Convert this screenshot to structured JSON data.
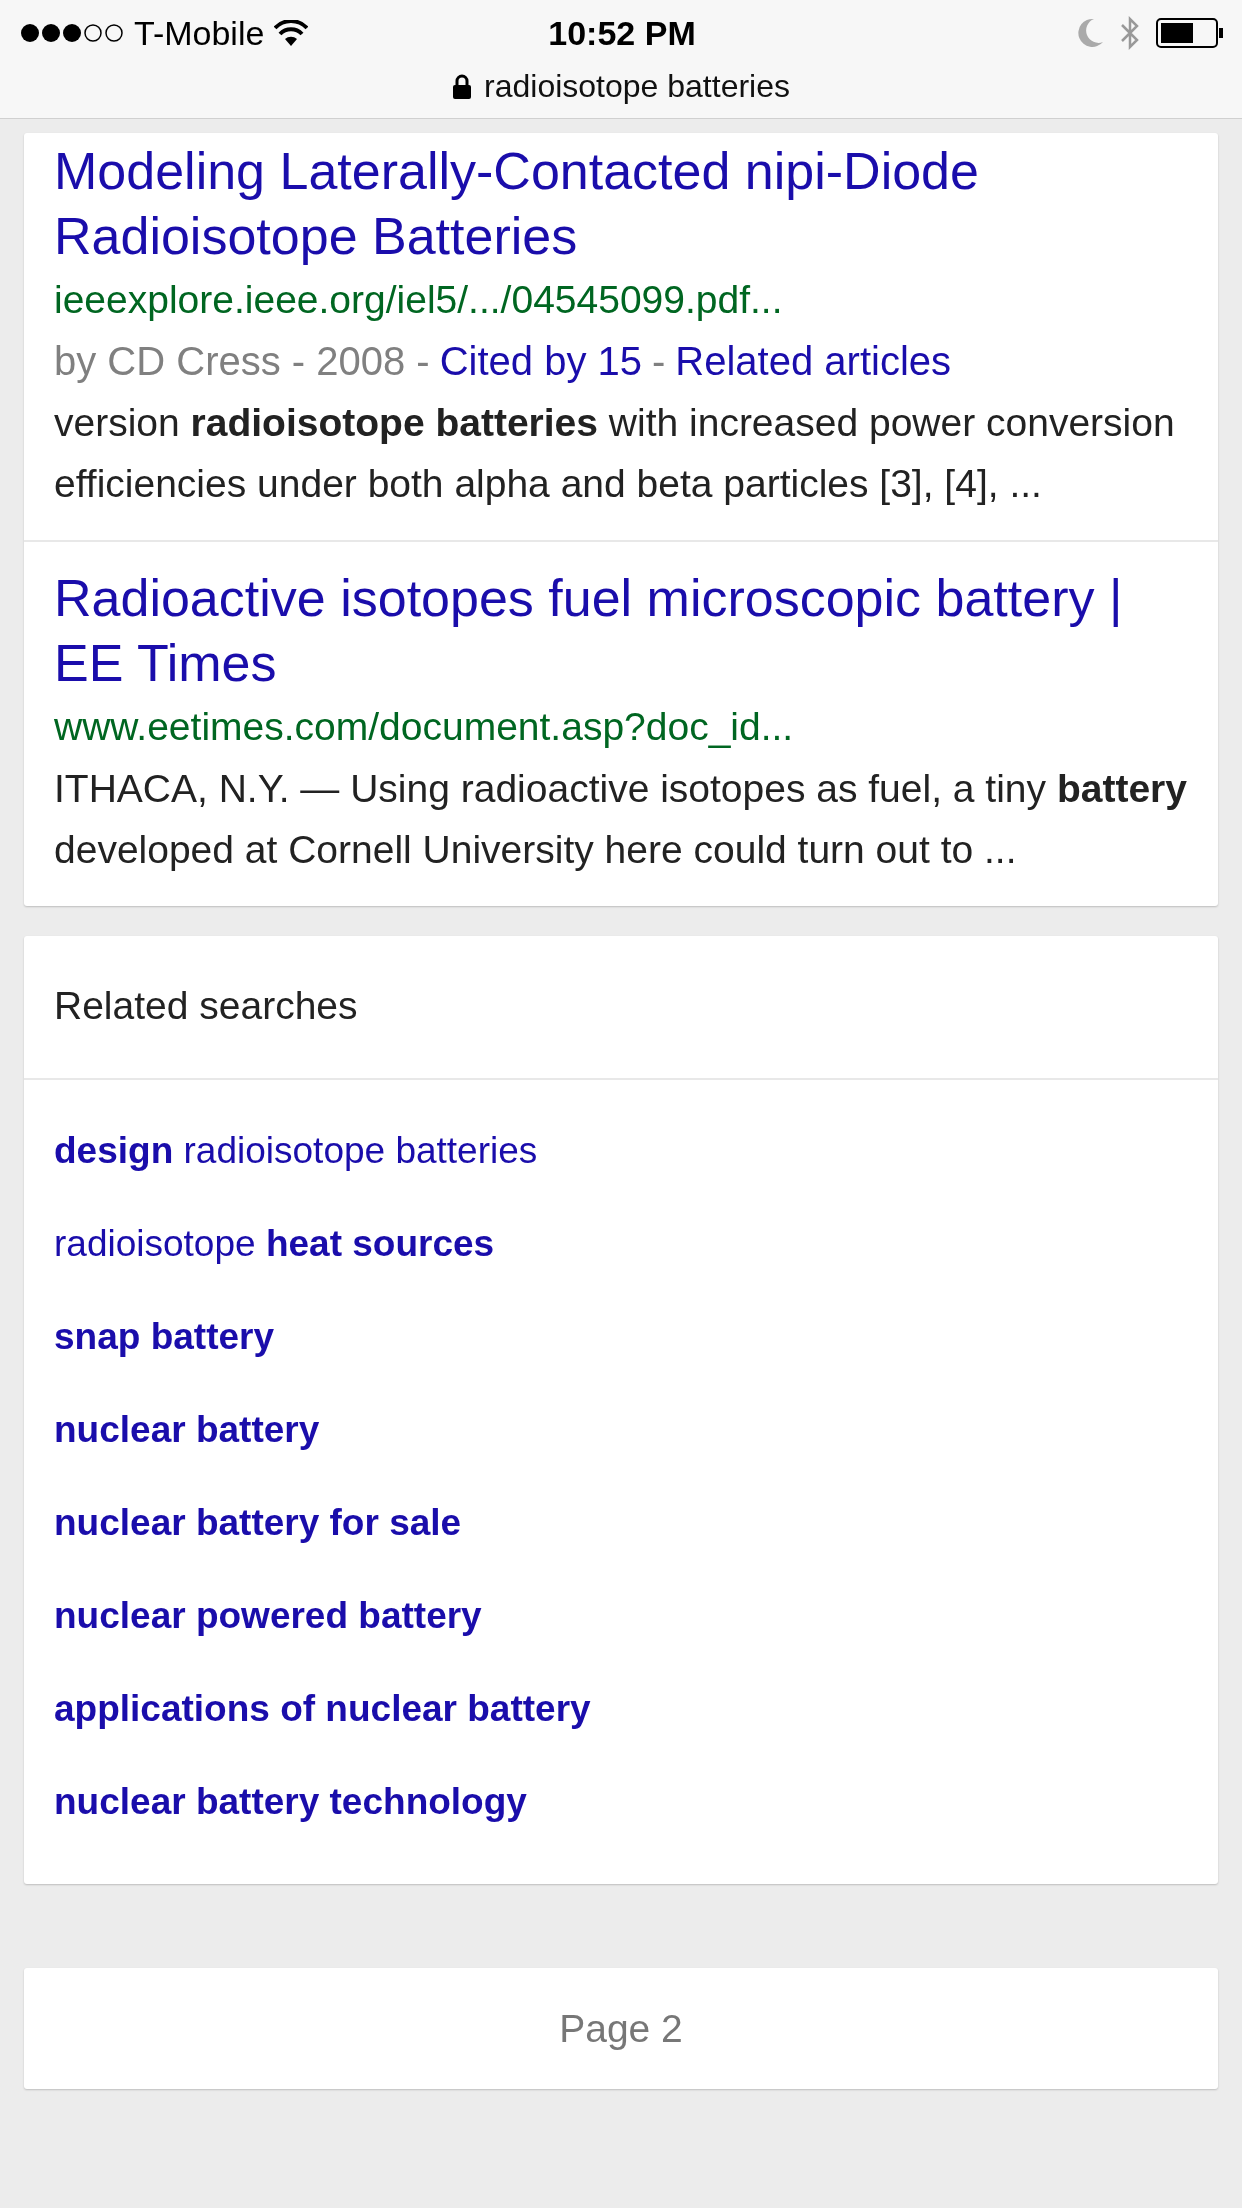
{
  "status_bar": {
    "carrier": "T-Mobile",
    "time": "10:52 PM"
  },
  "address_bar": {
    "text": "radioisotope batteries"
  },
  "results": [
    {
      "title": "Modeling Laterally-Contacted nipi-Diode Radioisotope Batteries",
      "url": "ieeexplore.ieee.org/iel5/.../04545099.pdf...",
      "meta": [
        {
          "kind": "plain",
          "text": "by CD Cress - 2008 -"
        },
        {
          "kind": "link",
          "text": "Cited by 15"
        },
        {
          "kind": "plain",
          "text": "-"
        },
        {
          "kind": "link",
          "text": "Related articles"
        }
      ],
      "snippet": "version **radioisotope batteries** with increased power conversion efficiencies under both alpha and beta particles [3], [4], ..."
    },
    {
      "title": "Radioactive isotopes fuel microscopic battery | EE Times",
      "url": "www.eetimes.com/document.asp?doc_id...",
      "snippet": "ITHACA, N.Y. — Using radioactive isotopes as fuel, a tiny **battery** developed at Cornell University here could turn out to ..."
    }
  ],
  "related_searches": {
    "title": "Related searches",
    "items": [
      {
        "text": "**design** radioisotope batteries"
      },
      {
        "text": "radioisotope **heat sources**"
      },
      {
        "text": "**snap battery**"
      },
      {
        "text": "**nuclear battery**"
      },
      {
        "text": "**nuclear battery for sale**"
      },
      {
        "text": "**nuclear powered battery**"
      },
      {
        "text": "**applications of nuclear battery**"
      },
      {
        "text": "**nuclear battery technology**"
      }
    ]
  },
  "pagination": {
    "label": "Page 2"
  }
}
